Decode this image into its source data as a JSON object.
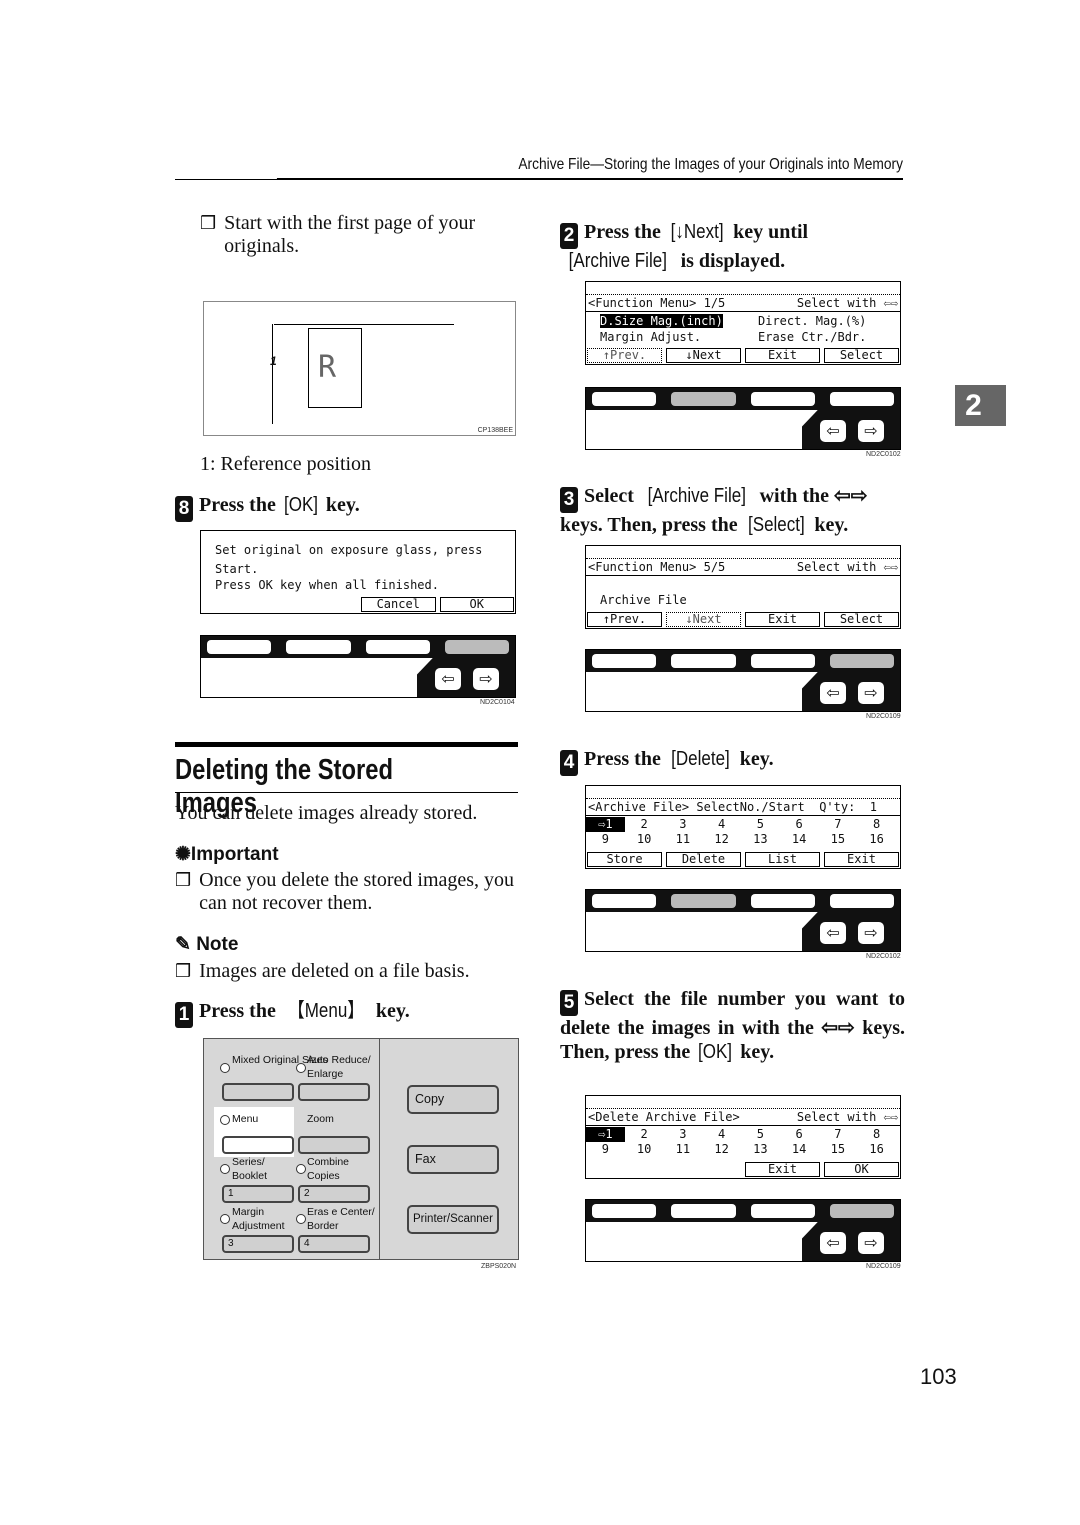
{
  "header": {
    "running_title": "Archive File—Storing the Images of your Originals into Memory",
    "chapter_tab": "2",
    "page_number": "103"
  },
  "left": {
    "bullet_start": "Start with the first page of your originals.",
    "figure1": {
      "callout": "1",
      "code": "CP138BEE",
      "caption": "1: Reference position"
    },
    "step8": {
      "num": "8",
      "pre": "Press the ",
      "key": "[OK]",
      "post": " key."
    },
    "lcd1": {
      "lines": [
        "Set original on exposure glass, press",
        "Start.",
        "Press OK key when all finished."
      ],
      "buttons": [
        "Cancel",
        "OK"
      ],
      "code": "ND2C0104"
    },
    "section_title": "Deleting the Stored Images",
    "intro": "You can delete images already stored.",
    "important_label": "Important",
    "important_text": "Once you delete the stored images, you can not recover them.",
    "note_label": "Note",
    "note_text": "Images are deleted on a file basis.",
    "step1": {
      "num": "1",
      "pre": "Press the ",
      "key": "【Menu】",
      "post": " key."
    },
    "control_panel": {
      "code": "ZBPS020N",
      "keys": [
        {
          "label": "Mixed Original Sizes"
        },
        {
          "label": "Auto Reduce/ Enlarge"
        },
        {
          "label": "Menu"
        },
        {
          "label": "Zoom"
        },
        {
          "label": "Series/ Booklet",
          "num": "1"
        },
        {
          "label": "Combine Copies",
          "num": "2"
        },
        {
          "label": "Margin Adjustment",
          "num": "3"
        },
        {
          "label": "Eras e Center/ Border",
          "num": "4"
        }
      ],
      "mode_keys": [
        "Copy",
        "Fax",
        "Printer/Scanner"
      ]
    }
  },
  "right": {
    "step2": {
      "num": "2",
      "pre": "Press the ",
      "key": "[↓Next]",
      "mid": " key until ",
      "key2": "[Archive File]",
      "post": " is displayed."
    },
    "lcd2": {
      "title": "<Function Menu> 1/5",
      "title_right": "Select with ⇦⇨",
      "rows": [
        [
          "D.Size Mag.(inch)",
          "Direct. Mag.(%)"
        ],
        [
          "Margin Adjust.",
          "Erase Ctr./Bdr."
        ]
      ],
      "buttons": [
        "↑Prev.",
        "↓Next",
        "Exit",
        "Select"
      ],
      "code": "ND2C0102"
    },
    "step3": {
      "num": "3",
      "pre": "Select ",
      "key": "[Archive File]",
      "mid": " with the ⇦⇨ keys. Then, press the ",
      "key2": "[Select]",
      "post": " key."
    },
    "lcd3": {
      "title": "<Function Menu> 5/5",
      "title_right": "Select with ⇦⇨",
      "row": "Archive File",
      "buttons": [
        "↑Prev.",
        "↓Next",
        "Exit",
        "Select"
      ],
      "code": "ND2C0109"
    },
    "step4": {
      "num": "4",
      "pre": "Press the ",
      "key": "[Delete]",
      "post": " key."
    },
    "lcd4": {
      "title": "<Archive File> SelectNo./Start  Q'ty:  1",
      "numbers1": [
        "⇨1",
        "2",
        "3",
        "4",
        "5",
        "6",
        "7",
        "8"
      ],
      "numbers2": [
        "9",
        "10",
        "11",
        "12",
        "13",
        "14",
        "15",
        "16"
      ],
      "buttons": [
        "Store",
        "Delete",
        "List",
        "Exit"
      ],
      "code": "ND2C0102"
    },
    "step5": {
      "num": "5",
      "pre": "Select the file number you want to delete the images in with the ⇦⇨ keys. Then, press the ",
      "key": "[OK]",
      "post": " key."
    },
    "lcd5": {
      "title": "<Delete Archive File>",
      "title_right": "Select with ⇦⇨",
      "numbers1": [
        "⇨1",
        "2",
        "3",
        "4",
        "5",
        "6",
        "7",
        "8"
      ],
      "numbers2": [
        "9",
        "10",
        "11",
        "12",
        "13",
        "14",
        "15",
        "16"
      ],
      "buttons": [
        "Exit",
        "OK"
      ],
      "code": "ND2C0109"
    }
  },
  "colors": {
    "text": "#111111",
    "tab": "#666666",
    "panel_gray": "#d7d7d7",
    "key_highlight": "#bbbbbb"
  }
}
